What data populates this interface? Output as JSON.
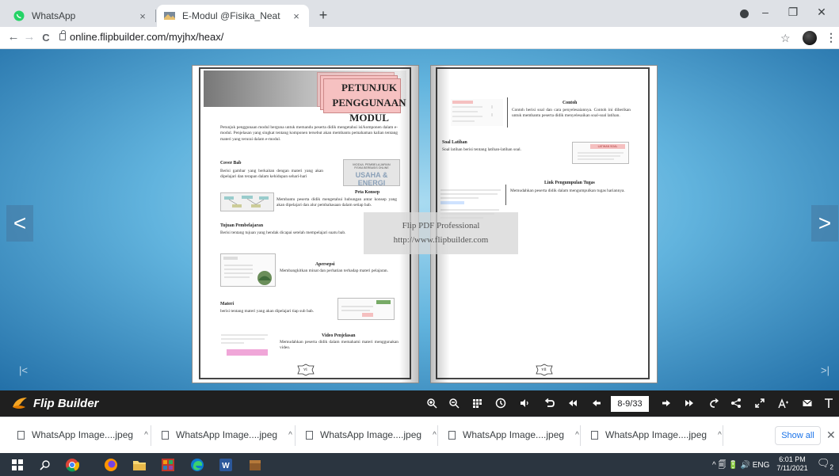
{
  "browser": {
    "tabs": [
      {
        "label": "WhatsApp",
        "close": "×"
      },
      {
        "label": "E-Modul @Fisika_Neat",
        "close": "×"
      }
    ],
    "new_tab": "+",
    "window": {
      "minimize": "–",
      "maximize": "❐",
      "close": "✕"
    },
    "nav": {
      "back": "←",
      "forward": "→",
      "reload": "C",
      "star": "☆",
      "menu": "⋮"
    },
    "url": "online.flipbuilder.com/myjhx/heax/"
  },
  "viewer": {
    "prev_arrow": "<",
    "next_arrow": ">",
    "first_edge": "|<",
    "last_edge": ">|",
    "watermark_line1": "Flip PDF Professional",
    "watermark_line2": "http://www.flipbuilder.com",
    "left_page": {
      "title_line1": "PETUNJUK",
      "title_line2": "PENGGUNAAN MODUL",
      "intro": "Petunjuk penggunaan modul berguna untuk memandu peserta didik mengetahui isi/komponen dalam e-modul. Penjelasan yang singkat tentang komponen tersebut akan membantu pemahaman kalian tentang materi yang terurai dalam e-modul.",
      "cover_head": "Cover Bab",
      "cover_text": "Berisi gambar yang berkaitan dengan materi yang akan dipelajari dan terapan dalam kehidupan sehari-hari",
      "cover_thumb_line1": "MODUL PEMBELAJARAN",
      "cover_thumb_line2": "FISIKA BERBASIS ONLINE",
      "cover_thumb_title": "USAHA & ENERGI",
      "peta_head": "Peta Konsep",
      "peta_text": "Membantu peserta didik mengetahui hubungan antar konsep yang akan dipelajari dan alur pembahasaan dalam setiap bab.",
      "tujuan_head": "Tujuan Pembelajaran",
      "tujuan_text": "Berisi tentang tujuan yang hendak dicapai setelah mempelajari suatu bab.",
      "apersepsi_head": "Apersepsi",
      "apersepsi_text": "Membangkitkan minat dan perhatian terhadap materi pelajaran.",
      "materi_head": "Materi",
      "materi_text": "berisi tentang materi yang akan dipelajari tiap sub bab.",
      "video_head": "Video Penjelasan",
      "video_text": "Memudahkan peserta didik dalam memahami materi menggunakan video.",
      "page_number": "vi"
    },
    "right_page": {
      "contoh_head": "Contoh",
      "contoh_text": "Contoh berisi soal dan cara penyelesaiannya. Contoh ini diberikan untuk membantu peserta didik menyelesaikan soal-soal latihan.",
      "latihan_head": "Soal Latihan",
      "latihan_text": "Soal latihan berisi tentang latihan-latihan soal.",
      "latihan_thumb": "LATIHAN SOAL",
      "link_head": "Link Pengumpulan Tugas",
      "link_text": "Memudahkan peserta didik dalam mengumpulkan tugas hariannya.",
      "page_number": "vii"
    }
  },
  "flipbuilder": {
    "brand": "Flip Builder",
    "page_indicator": "8-9/33",
    "tools": [
      "zoom-in",
      "zoom-out",
      "thumbnails",
      "autoplay",
      "sound",
      "undo",
      "first-page",
      "prev-page",
      "next-page",
      "last-page",
      "share-back",
      "share",
      "fullscreen",
      "text-size",
      "email",
      "text"
    ]
  },
  "downloads": {
    "items": [
      {
        "label": "WhatsApp Image....jpeg"
      },
      {
        "label": "WhatsApp Image....jpeg"
      },
      {
        "label": "WhatsApp Image....jpeg"
      },
      {
        "label": "WhatsApp Image....jpeg"
      },
      {
        "label": "WhatsApp Image....jpeg"
      }
    ],
    "caret": "^",
    "show_all": "Show all",
    "close": "✕"
  },
  "taskbar": {
    "tray": "^ 🗐 🔋 🔊 ENG",
    "time": "6:01 PM",
    "date": "7/11/2021",
    "notifications": "2"
  },
  "colors": {
    "accent": "#1a73e8",
    "whatsapp": "#25d366",
    "pink_card": "#f6c1c1",
    "fb_bar": "#1f1f1f"
  }
}
